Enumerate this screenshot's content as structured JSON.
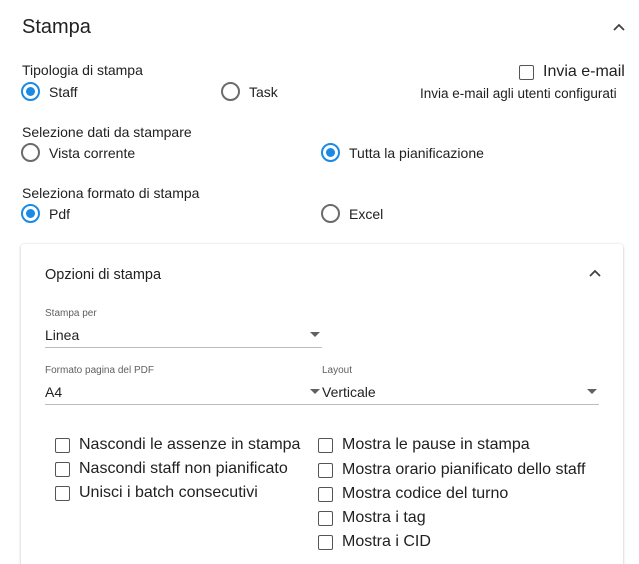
{
  "section": {
    "title": "Stampa"
  },
  "print_type": {
    "label": "Tipologia di stampa",
    "options": [
      {
        "label": "Staff",
        "selected": true
      },
      {
        "label": "Task",
        "selected": false
      }
    ]
  },
  "email": {
    "checkbox_label": "Invia e-mail",
    "checked": false,
    "description": "Invia e-mail agli utenti configurati"
  },
  "data_selection": {
    "label": "Selezione dati da stampare",
    "options": [
      {
        "label": "Vista corrente",
        "selected": false
      },
      {
        "label": "Tutta la pianificazione",
        "selected": true
      }
    ]
  },
  "format": {
    "label": "Seleziona formato di stampa",
    "options": [
      {
        "label": "Pdf",
        "selected": true
      },
      {
        "label": "Excel",
        "selected": false
      }
    ]
  },
  "options_panel": {
    "title": "Opzioni di stampa",
    "print_by": {
      "label": "Stampa per",
      "value": "Linea"
    },
    "page_format": {
      "label": "Formato pagina del PDF",
      "value": "A4"
    },
    "layout": {
      "label": "Layout",
      "value": "Verticale"
    },
    "left_checks": [
      {
        "label": "Nascondi le assenze in stampa",
        "checked": false
      },
      {
        "label": "Nascondi staff non pianificato",
        "checked": false
      },
      {
        "label": "Unisci i batch consecutivi",
        "checked": false
      }
    ],
    "right_checks": [
      {
        "label": "Mostra le pause in stampa",
        "checked": false
      },
      {
        "label": "Mostra orario pianificato dello staff",
        "checked": false
      },
      {
        "label": "Mostra codice del turno",
        "checked": false
      },
      {
        "label": "Mostra i tag",
        "checked": false
      },
      {
        "label": "Mostra i CID",
        "checked": false
      }
    ]
  },
  "colors": {
    "accent": "#1a8ae5",
    "text": "#212121",
    "muted": "#5f5f5f"
  },
  "icons": {
    "collapse": "chevron-up-icon",
    "dropdown": "caret-down-icon"
  }
}
